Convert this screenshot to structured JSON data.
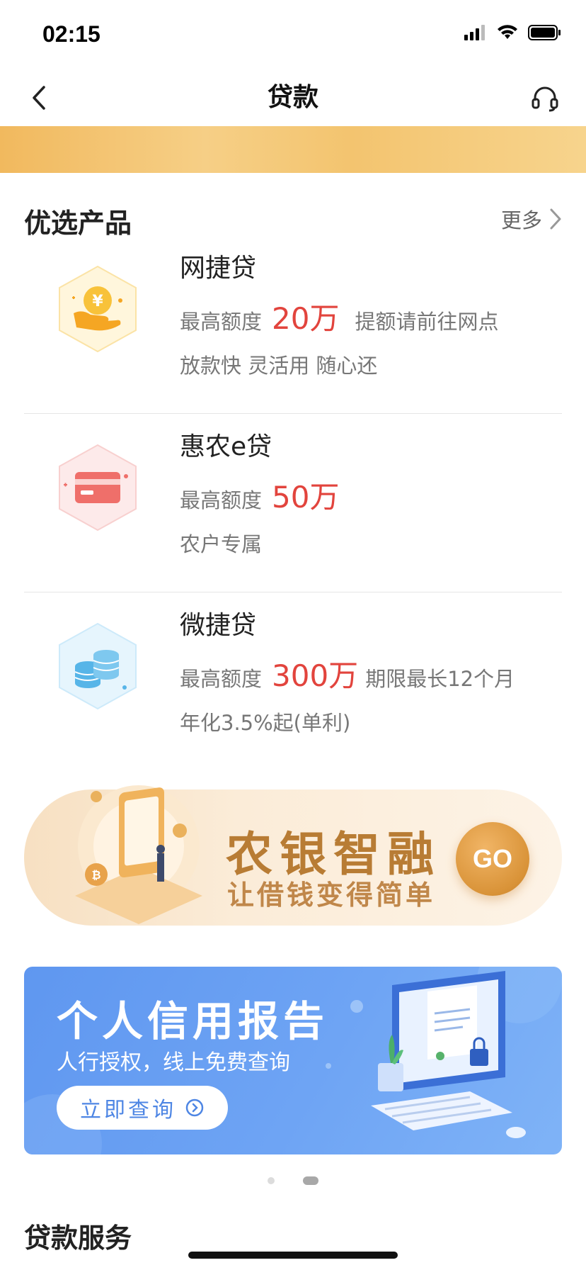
{
  "status_bar": {
    "time": "02:15"
  },
  "nav": {
    "title": "贷款",
    "back_icon": "chevron-left-icon",
    "service_icon": "headset-icon"
  },
  "preferred": {
    "title": "优选产品",
    "more_label": "更多",
    "products": [
      {
        "name": "网捷贷",
        "limit_label": "最高额度",
        "limit_value": "20万",
        "extra": "提额请前往网点",
        "desc": "放款快 灵活用 随心还",
        "icon": "coin-in-hand-icon",
        "accent": "#f5c24c"
      },
      {
        "name": "惠农e贷",
        "limit_label": "最高额度",
        "limit_value": "50万",
        "extra": "",
        "desc": "农户专属",
        "icon": "bank-card-icon",
        "accent": "#ef6f6a"
      },
      {
        "name": "微捷贷",
        "limit_label": "最高额度",
        "limit_value": "300万",
        "extra": "期限最长12个月",
        "desc": "年化3.5%起(单利)",
        "icon": "coin-stack-icon",
        "accent": "#57b5e8"
      }
    ]
  },
  "promo_smart": {
    "title": "农银智融",
    "subtitle": "让借钱变得简单",
    "button": "GO"
  },
  "promo_credit": {
    "title": "个人信用报告",
    "subtitle": "人行授权，线上免费查询",
    "button": "立即查询"
  },
  "pager": {
    "count": 2,
    "active_index": 1
  },
  "loan_service": {
    "title": "贷款服务"
  },
  "colors": {
    "highlight_red": "#e2443d",
    "brand_gold": "#d99338",
    "banner_blue": "#6ea4f4"
  }
}
